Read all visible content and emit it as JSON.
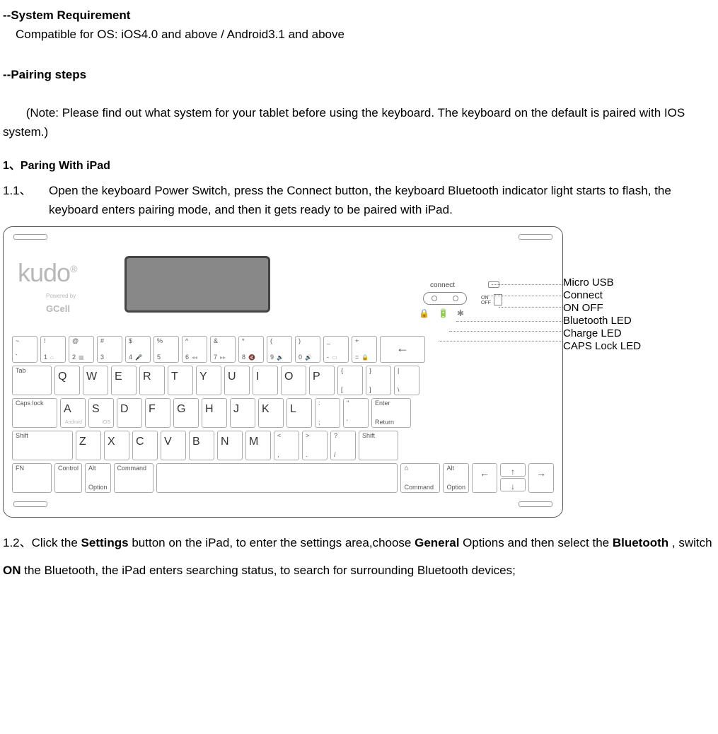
{
  "sections": {
    "sysreq_head": "--System Requirement",
    "sysreq_body": "Compatible for OS: iOS4.0 and above / Android3.1 and above",
    "pairing_head": "--Pairing steps",
    "pairing_note": "(Note: Please find out what system for your tablet before using the keyboard. The keyboard on the default is paired with IOS system.)",
    "ipad_head": "1、Paring With iPad",
    "step11_num": "1.1、",
    "step11_body": "Open the keyboard Power Switch, press the Connect button, the keyboard Bluetooth indicator light starts to flash, the keyboard enters pairing mode, and then it gets ready to be paired with iPad.",
    "step12_a": "1.2、Click the ",
    "step12_b": "Settings",
    "step12_c": " button on the iPad, to enter the settings area,choose ",
    "step12_d": "General",
    "step12_e": " Options and then select the ",
    "step12_f": "Bluetooth",
    "step12_g": " , switch ",
    "step12_h": "ON",
    "step12_i": " the Bluetooth, the iPad enters searching status, to search for surrounding Bluetooth devices;"
  },
  "keyboard": {
    "brand": "kudo",
    "brand_sub_prefix": "Powered by",
    "brand_sub": "GCell",
    "connect_label": "connect",
    "onoff_on": "ON",
    "onoff_off": "OFF",
    "annotations": [
      "Micro USB",
      "Connect",
      "ON OFF",
      "Bluetooth LED",
      "Charge LED",
      "CAPS Lock LED"
    ],
    "led_icons": [
      "🔒",
      "🔋",
      "✱"
    ],
    "row1": [
      {
        "t": "~",
        "b": "`"
      },
      {
        "t": "!",
        "b": "1",
        "i": "⌂"
      },
      {
        "t": "@",
        "b": "2",
        "i": "▦"
      },
      {
        "t": "#",
        "b": "3"
      },
      {
        "t": "$",
        "b": "4",
        "i": "🎤"
      },
      {
        "t": "%",
        "b": "5"
      },
      {
        "t": "^",
        "b": "6",
        "i": "◂◂"
      },
      {
        "t": "&",
        "b": "7",
        "i": "▸▸"
      },
      {
        "t": "*",
        "b": "8",
        "i": "🔇"
      },
      {
        "t": "(",
        "b": "9",
        "i": "🔉"
      },
      {
        "t": ")",
        "b": "0",
        "i": "🔊"
      },
      {
        "t": "_",
        "b": "-",
        "i": "▭"
      },
      {
        "t": "+",
        "b": "=",
        "i": "🔒"
      }
    ],
    "backspace": "←",
    "row2_lead": "Tab",
    "row2": [
      "Q",
      "W",
      "E",
      "R",
      "T",
      "Y",
      "U",
      "I",
      "O",
      "P"
    ],
    "row2_sym": [
      {
        "t": "{",
        "b": "["
      },
      {
        "t": "}",
        "b": "]"
      },
      {
        "t": "|",
        "b": "\\"
      }
    ],
    "row3_lead": "Caps lock",
    "row3": [
      "A",
      "S",
      "D",
      "F",
      "G",
      "H",
      "J",
      "K",
      "L"
    ],
    "row3_sub_a": "Android",
    "row3_sub_s": "iOS",
    "row3_sym": [
      {
        "t": ":",
        "b": ";"
      },
      {
        "t": "\"",
        "b": "'"
      }
    ],
    "row3_enter_t": "Enter",
    "row3_enter_b": "Return",
    "row4_lead": "Shift",
    "row4": [
      "Z",
      "X",
      "C",
      "V",
      "B",
      "N",
      "M"
    ],
    "row4_sym": [
      {
        "t": "<",
        "b": ","
      },
      {
        "t": ">",
        "b": "."
      },
      {
        "t": "?",
        "b": "/"
      }
    ],
    "row4_shift": "Shift",
    "row5": {
      "fn": "FN",
      "control": "Control",
      "alt_t": "Alt",
      "opt_b": "Option",
      "cmd": "Command",
      "cmd2": "Command",
      "alt2_t": "Alt",
      "opt2_b": "Option",
      "up": "↑",
      "down": "↓",
      "left": "←",
      "right": "→"
    }
  }
}
